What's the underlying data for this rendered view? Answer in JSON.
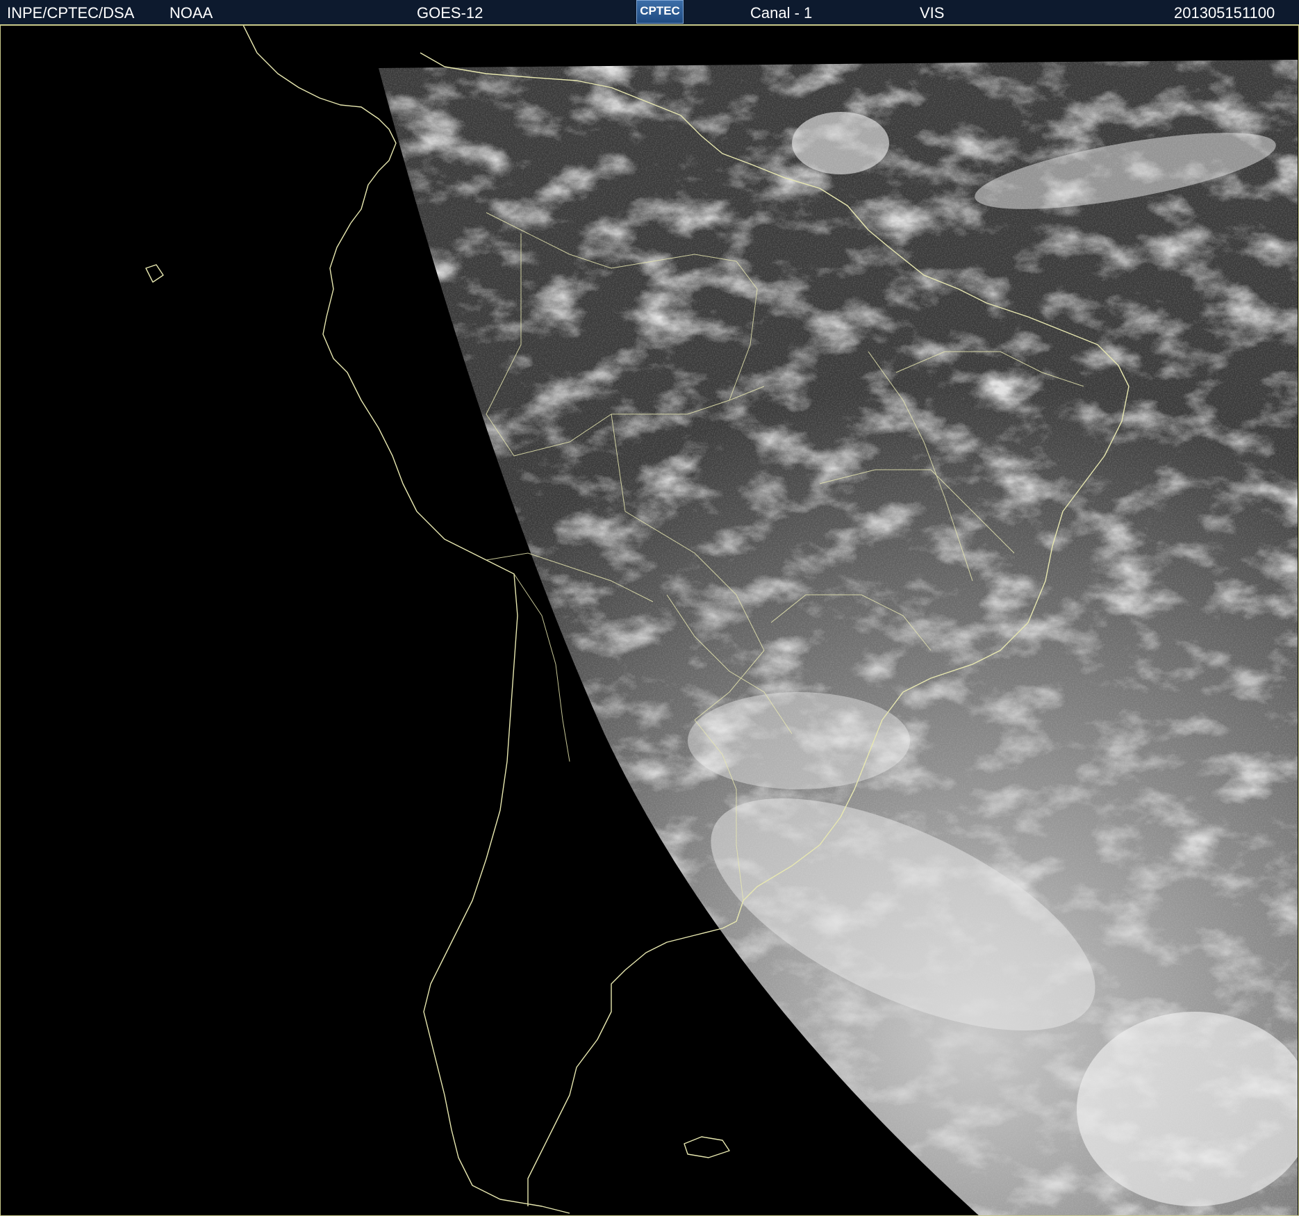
{
  "header": {
    "org": "INPE/CPTEC/DSA",
    "agency": "NOAA",
    "satellite": "GOES-12",
    "logo_text": "CPTEC",
    "channel": "Canal - 1",
    "band": "VIS",
    "timestamp": "201305151100"
  },
  "colors": {
    "header_bg": "#0d1a2e",
    "coastline": "#e8e8b0",
    "space": "#000000",
    "cloud": "#f2f2f2",
    "surface": "#3a3a3a"
  },
  "icons": {
    "logo": "cptec-logo"
  }
}
